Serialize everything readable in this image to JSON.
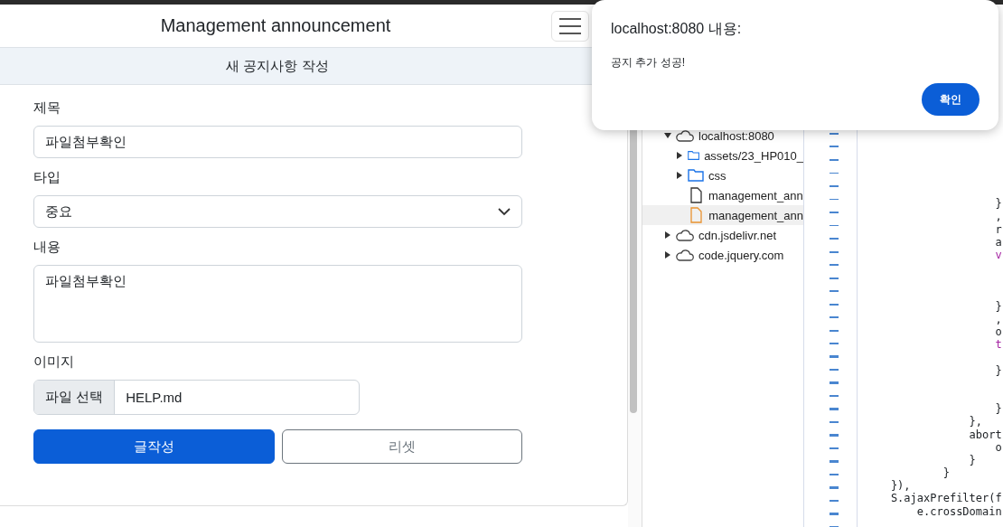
{
  "header": {
    "title": "Management announcement"
  },
  "card": {
    "title": "새 공지사항 작성",
    "fields": [
      {
        "kind": "text",
        "label": "제목",
        "value": "파일첨부확인"
      },
      {
        "kind": "select",
        "label": "타입",
        "value": "중요"
      },
      {
        "kind": "textarea",
        "label": "내용",
        "value": "파일첨부확인"
      },
      {
        "kind": "file",
        "label": "이미지",
        "button": "파일 선택",
        "value": "HELP.md"
      }
    ],
    "buttons": [
      {
        "label": "글작성",
        "kind": "primary"
      },
      {
        "label": "리셋",
        "kind": "outline"
      }
    ]
  },
  "devtools": {
    "tree": [
      {
        "kind": "domain",
        "label": "localhost:8080",
        "expanded": true,
        "selected": false,
        "children": [
          {
            "kind": "folder",
            "label": "assets/23_HP010_",
            "expanded": false,
            "selected": false
          },
          {
            "kind": "folder",
            "label": "css",
            "expanded": false,
            "selected": false
          },
          {
            "kind": "file",
            "label": "management_ann",
            "selected": false
          },
          {
            "kind": "file",
            "label": "management_ann",
            "selected": true
          }
        ]
      },
      {
        "kind": "domain",
        "label": "cdn.jsdelivr.net",
        "expanded": false,
        "selected": false
      },
      {
        "kind": "domain",
        "label": "code.jquery.com",
        "expanded": false,
        "selected": false
      }
    ],
    "code": [
      {
        "kind": "blank"
      },
      {
        "kind": "blank"
      },
      {
        "kind": "blank"
      },
      {
        "kind": "blank"
      },
      {
        "kind": "blank"
      },
      {
        "kind": "blank"
      },
      {
        "kind": "plain",
        "text": "                    }"
      },
      {
        "kind": "plain",
        "text": "                    ,"
      },
      {
        "kind": "plain",
        "text": "                    r"
      },
      {
        "kind": "plain",
        "text": "                    a"
      },
      {
        "kind": "keyword",
        "text": "                    v"
      },
      {
        "kind": "blank"
      },
      {
        "kind": "blank"
      },
      {
        "kind": "blank"
      },
      {
        "kind": "plain",
        "text": "                    }"
      },
      {
        "kind": "plain",
        "text": "                    ,"
      },
      {
        "kind": "plain",
        "text": "                    o"
      },
      {
        "kind": "keyword",
        "text": "                    t"
      },
      {
        "kind": "blank"
      },
      {
        "kind": "plain",
        "text": "                    }"
      },
      {
        "kind": "blank"
      },
      {
        "kind": "blank"
      },
      {
        "kind": "plain",
        "text": "                    }"
      },
      {
        "kind": "plain",
        "text": "                },"
      },
      {
        "kind": "plain",
        "text": "                abort"
      },
      {
        "kind": "plain",
        "text": "                    o"
      },
      {
        "kind": "plain",
        "text": "                }"
      },
      {
        "kind": "plain",
        "text": "            }"
      },
      {
        "kind": "plain",
        "text": "    }),"
      },
      {
        "kind": "plain",
        "text": "    S.ajaxPrefilter(f"
      },
      {
        "kind": "plain",
        "text": "        e.crossDomain"
      }
    ]
  },
  "dialog": {
    "title": "localhost:8080 내용:",
    "message": "공지 추가 성공!",
    "button": "확인"
  }
}
